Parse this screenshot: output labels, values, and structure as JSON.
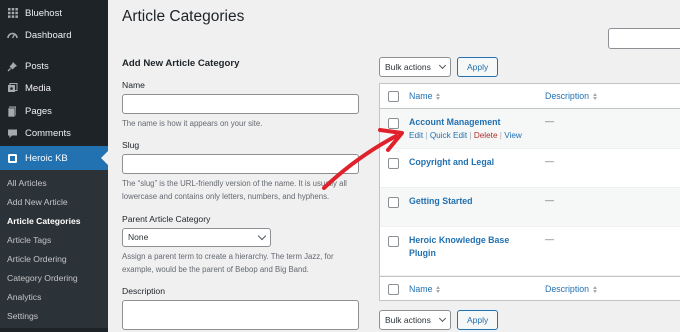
{
  "sidebar": {
    "items": [
      {
        "label": "Bluehost",
        "icon": "grid-icon"
      },
      {
        "label": "Dashboard",
        "icon": "dashboard-icon"
      },
      {
        "label": "Posts",
        "icon": "pin-icon"
      },
      {
        "label": "Media",
        "icon": "media-icon"
      },
      {
        "label": "Pages",
        "icon": "pages-icon"
      },
      {
        "label": "Comments",
        "icon": "comment-icon"
      },
      {
        "label": "Heroic KB",
        "icon": "heroic-kb-icon"
      }
    ],
    "submenu": [
      "All Articles",
      "Add New Article",
      "Article Categories",
      "Article Tags",
      "Article Ordering",
      "Category Ordering",
      "Analytics",
      "Settings"
    ]
  },
  "page": {
    "title": "Article Categories"
  },
  "form": {
    "title": "Add New Article Category",
    "name_label": "Name",
    "name_help": "The name is how it appears on your site.",
    "slug_label": "Slug",
    "slug_help": "The “slug” is the URL-friendly version of the name. It is usually all lowercase and contains only letters, numbers, and hyphens.",
    "parent_label": "Parent Article Category",
    "parent_value": "None",
    "parent_help": "Assign a parent term to create a hierarchy. The term Jazz, for example, would be the parent of Bebop and Big Band.",
    "description_label": "Description"
  },
  "bulk": {
    "label": "Bulk actions",
    "apply": "Apply"
  },
  "table": {
    "col_name": "Name",
    "col_description": "Description",
    "rows": [
      {
        "name": "Account Management",
        "description": "—"
      },
      {
        "name": "Copyright and Legal",
        "description": "—"
      },
      {
        "name": "Getting Started",
        "description": "—"
      },
      {
        "name": "Heroic Knowledge Base Plugin",
        "description": "—"
      }
    ],
    "row_actions": {
      "edit": "Edit",
      "quick_edit": "Quick Edit",
      "delete": "Delete",
      "view": "View",
      "sep": "|"
    }
  },
  "colors": {
    "accent": "#2271b1",
    "sidebar": "#1d2327",
    "arrow": "#e0202a",
    "delete": "#b32d2e"
  }
}
